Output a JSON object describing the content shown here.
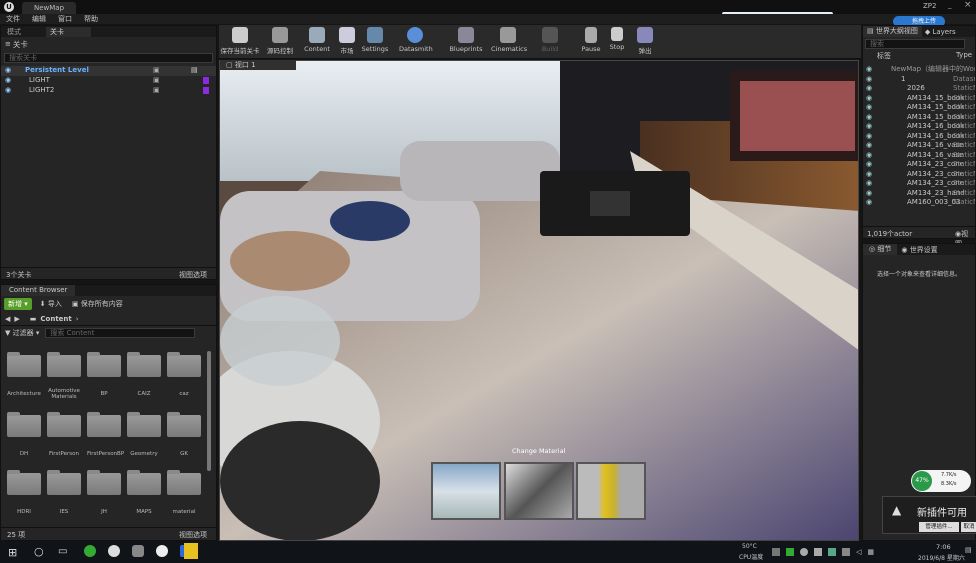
{
  "title_tab": "NewMap",
  "top_right_tab": "ZP2",
  "menu": [
    "文件",
    "编辑",
    "窗口",
    "帮助"
  ],
  "left_tabs": {
    "modes": "模式",
    "levels": "关卡"
  },
  "levels_panel": {
    "header": "关卡",
    "search_placeholder": "搜索关卡",
    "items": [
      "Persistent Level",
      "LIGHT",
      "LIGHT2"
    ],
    "count": "3个关卡",
    "view_options": "视图选项"
  },
  "content_browser": {
    "tab": "Content Browser",
    "add_new": "新增",
    "import": "导入",
    "save_all": "保存所有内容",
    "path": "Content",
    "filters": "过滤器",
    "search_placeholder": "搜索 Content",
    "folders": [
      "Architecture",
      "Automotive Materials",
      "BP",
      "CAIZ",
      "caz",
      "DH",
      "FirstPerson",
      "FirstPersonBP",
      "Geometry",
      "GK",
      "HDRI",
      "IES",
      "JH",
      "MAPS",
      "material"
    ],
    "count": "25 项",
    "view_options": "视图选项"
  },
  "toolbar": [
    {
      "label": "保存当前关卡",
      "icon": "save-icon"
    },
    {
      "label": "源码控制",
      "icon": "source-control-icon"
    },
    {
      "label": "Content",
      "icon": "content-icon"
    },
    {
      "label": "市场",
      "icon": "marketplace-icon"
    },
    {
      "label": "Settings",
      "icon": "settings-icon"
    },
    {
      "label": "Datasmith",
      "icon": "datasmith-icon"
    },
    {
      "label": "Blueprints",
      "icon": "blueprints-icon"
    },
    {
      "label": "Cinematics",
      "icon": "cinematics-icon"
    },
    {
      "label": "Build",
      "icon": "build-icon"
    },
    {
      "label": "Pause",
      "icon": "pause-icon"
    },
    {
      "label": "Stop",
      "icon": "stop-icon"
    },
    {
      "label": "弹出",
      "icon": "eject-icon"
    }
  ],
  "viewport": {
    "tab": "视口 1",
    "change_material": "Change Material"
  },
  "outliner": {
    "tab": "世界大纲视图",
    "layers_tab": "Layers",
    "search_placeholder": "搜索",
    "col_label": "标签",
    "col_type": "Type",
    "rows": [
      {
        "name": "NewMap（编辑器中的World",
        "type": ""
      },
      {
        "name": "1",
        "type": "Datasm"
      },
      {
        "name": "2026",
        "type": "StaticM"
      },
      {
        "name": "AM134_15_book",
        "type": "StaticM"
      },
      {
        "name": "AM134_15_book",
        "type": "StaticM"
      },
      {
        "name": "AM134_15_book",
        "type": "StaticM"
      },
      {
        "name": "AM134_16_book",
        "type": "StaticM"
      },
      {
        "name": "AM134_16_book",
        "type": "StaticM"
      },
      {
        "name": "AM134_16_vase",
        "type": "StaticM"
      },
      {
        "name": "AM134_16_vase",
        "type": "StaticM"
      },
      {
        "name": "AM134_23_cone",
        "type": "StaticM"
      },
      {
        "name": "AM134_23_cone",
        "type": "StaticM"
      },
      {
        "name": "AM134_23_cone",
        "type": "StaticM"
      },
      {
        "name": "AM134_23_hand",
        "type": "StaticM"
      },
      {
        "name": "AM160_003_03",
        "type": "StaticM"
      }
    ],
    "count": "1,019个actor",
    "view": "视图"
  },
  "details": {
    "tab": "细节",
    "world_settings_tab": "世界设置",
    "hint": "选择一个对象来查看详细信息。"
  },
  "notification": {
    "title": "新插件可用",
    "manage": "管理插件...",
    "dismiss": "取消"
  },
  "net_widget": {
    "percent": "47%",
    "up": "7.7K/s",
    "down": "8.3K/s"
  },
  "upload_button": "拖拽上传",
  "taskbar": {
    "temp": "50°C",
    "cpu_label": "CPU温度",
    "time": "7:06",
    "date": "2019/6/8 星期六"
  },
  "colors": {
    "accent": "#4a8fd8",
    "green": "#5a9e2a",
    "purple": "#8a2be2"
  }
}
